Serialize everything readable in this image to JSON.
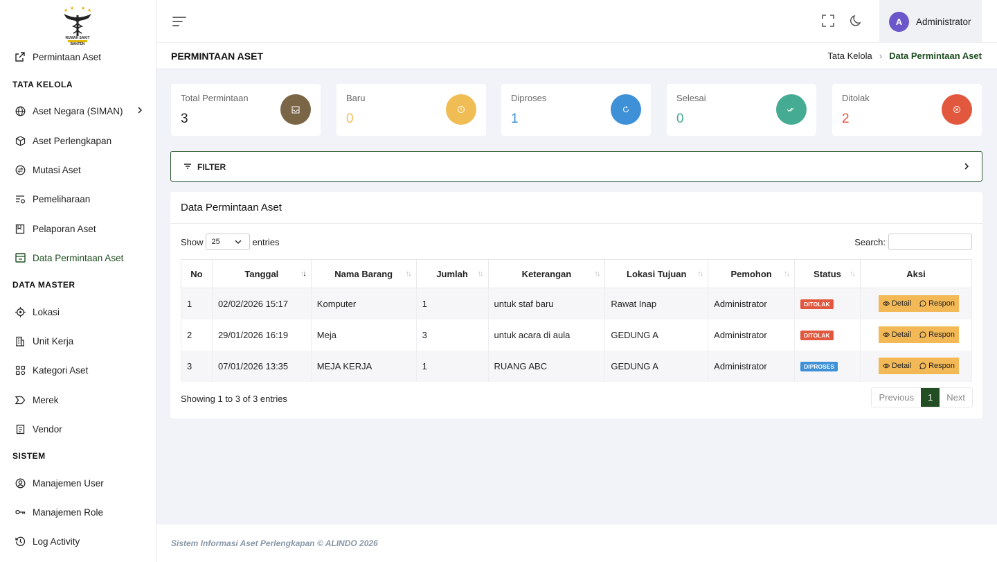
{
  "sidebar": {
    "logo_text": [
      "RUMAH SAKIT",
      "BANTEN"
    ],
    "items_top": [
      {
        "label": "Permintaan Aset",
        "icon": "external-link-icon"
      }
    ],
    "sections": [
      {
        "heading": "TATA KELOLA",
        "items": [
          {
            "label": "Aset Negara (SIMAN)",
            "icon": "globe-icon",
            "has_children": true
          },
          {
            "label": "Aset Perlengkapan",
            "icon": "box-icon"
          },
          {
            "label": "Mutasi Aset",
            "icon": "exchange-icon"
          },
          {
            "label": "Pemeliharaan",
            "icon": "settings-list-icon"
          },
          {
            "label": "Pelaporan Aset",
            "icon": "report-icon"
          },
          {
            "label": "Data Permintaan Aset",
            "icon": "inbox-icon",
            "active": true
          }
        ]
      },
      {
        "heading": "DATA MASTER",
        "items": [
          {
            "label": "Lokasi",
            "icon": "target-icon"
          },
          {
            "label": "Unit Kerja",
            "icon": "building-icon"
          },
          {
            "label": "Kategori Aset",
            "icon": "category-icon"
          },
          {
            "label": "Merek",
            "icon": "tag-icon"
          },
          {
            "label": "Vendor",
            "icon": "vendor-icon"
          }
        ]
      },
      {
        "heading": "SISTEM",
        "items": [
          {
            "label": "Manajemen User",
            "icon": "user-circle-icon"
          },
          {
            "label": "Manajemen Role",
            "icon": "key-icon"
          },
          {
            "label": "Log Activity",
            "icon": "history-icon"
          }
        ]
      }
    ]
  },
  "topbar": {
    "user_initial": "A",
    "user_name": "Administrator"
  },
  "page": {
    "title": "PERMINTAAN ASET",
    "breadcrumb": [
      "Tata Kelola",
      "Data Permintaan Aset"
    ]
  },
  "stats": [
    {
      "label": "Total Permintaan",
      "value": "3",
      "color": "#7a6646",
      "value_color": "#222222",
      "icon": "inbox-icon"
    },
    {
      "label": "Baru",
      "value": "0",
      "color": "#f0bd55",
      "value_color": "#f0bd55",
      "icon": "clock-icon"
    },
    {
      "label": "Diproses",
      "value": "1",
      "color": "#3e91d6",
      "value_color": "#3e91d6",
      "icon": "refresh-icon"
    },
    {
      "label": "Selesai",
      "value": "0",
      "color": "#45ab92",
      "value_color": "#45ab92",
      "icon": "check-double-icon"
    },
    {
      "label": "Ditolak",
      "value": "2",
      "color": "#e2583e",
      "value_color": "#e2583e",
      "icon": "close-circle-icon"
    }
  ],
  "filter": {
    "label": "FILTER"
  },
  "table_panel": {
    "title": "Data Permintaan Aset",
    "show_label": "Show",
    "entries_value": "25",
    "entries_label": "entries",
    "search_label": "Search:",
    "columns": [
      "No",
      "Tanggal",
      "Nama Barang",
      "Jumlah",
      "Keterangan",
      "Lokasi Tujuan",
      "Pemohon",
      "Status",
      "Aksi"
    ],
    "rows": [
      {
        "no": "1",
        "tanggal": "02/02/2026 15:17",
        "nama": "Komputer",
        "jumlah": "1",
        "ket": "untuk staf baru",
        "lokasi": "Rawat Inap",
        "pemohon": "Administrator",
        "status": "DITOLAK",
        "status_color": "#e2583e"
      },
      {
        "no": "2",
        "tanggal": "29/01/2026 16:19",
        "nama": "Meja",
        "jumlah": "3",
        "ket": "untuk acara di aula",
        "lokasi": "GEDUNG A",
        "pemohon": "Administrator",
        "status": "DITOLAK",
        "status_color": "#e2583e"
      },
      {
        "no": "3",
        "tanggal": "07/01/2026 13:35",
        "nama": "MEJA KERJA",
        "jumlah": "1",
        "ket": "RUANG ABC",
        "lokasi": "GEDUNG A",
        "pemohon": "Administrator",
        "status": "DIPROSES",
        "status_color": "#3e91d6"
      }
    ],
    "detail_label": "Detail",
    "respon_label": "Respon",
    "info": "Showing 1 to 3 of 3 entries",
    "pager": {
      "prev": "Previous",
      "current": "1",
      "next": "Next"
    }
  },
  "footer": {
    "text": "Sistem Informasi Aset Perlengkapan © ALINDO 2026"
  }
}
